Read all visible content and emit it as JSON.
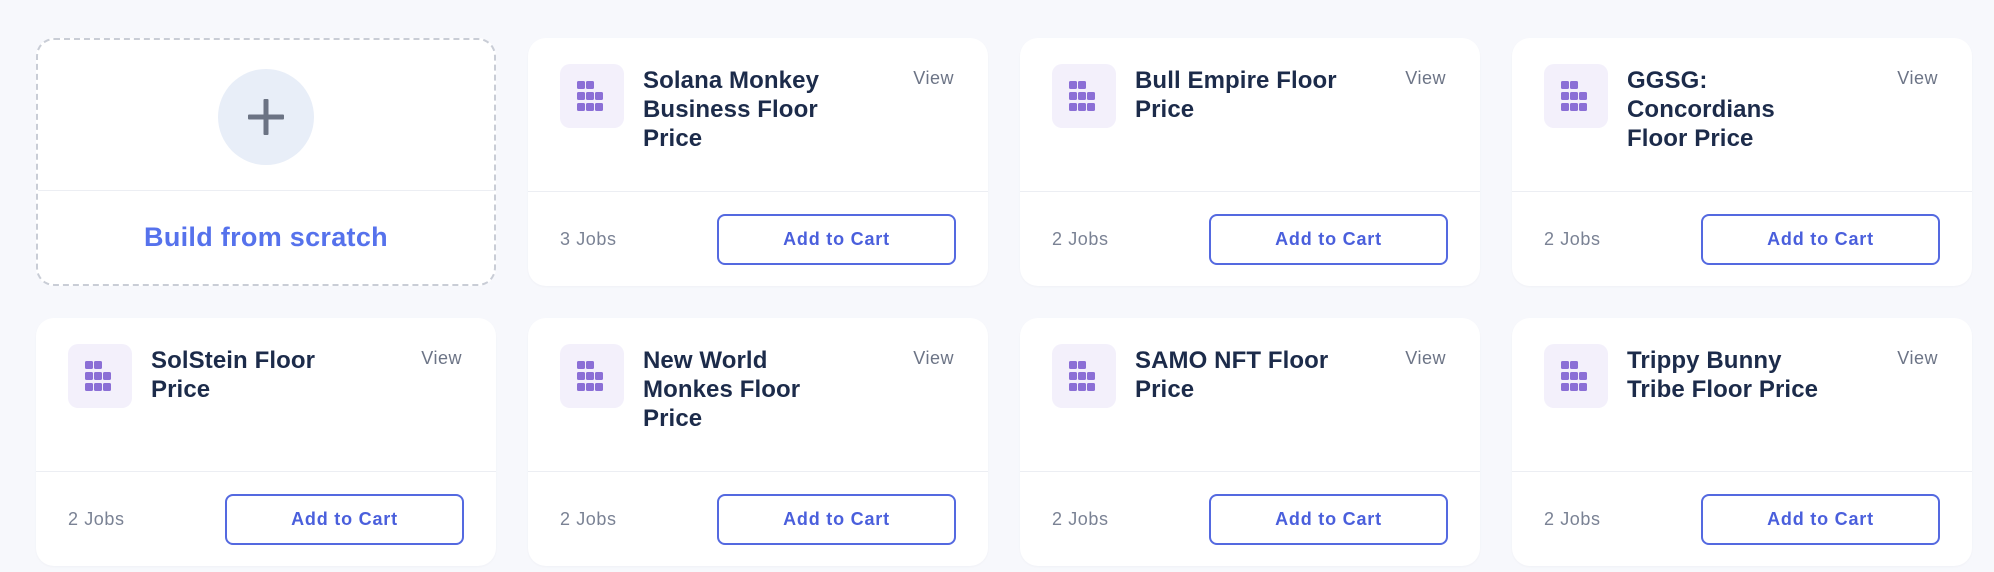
{
  "new_card": {
    "label": "Build from scratch",
    "icon": "plus-icon"
  },
  "templates": [
    {
      "title": "Solana Monkey Business Floor Price",
      "view_label": "View",
      "jobs": "3 Jobs",
      "cart_label": "Add to Cart",
      "icon": "blocks-icon"
    },
    {
      "title": "Bull Empire Floor Price",
      "view_label": "View",
      "jobs": "2 Jobs",
      "cart_label": "Add to Cart",
      "icon": "blocks-icon"
    },
    {
      "title": "GGSG: Concordians Floor Price",
      "view_label": "View",
      "jobs": "2 Jobs",
      "cart_label": "Add to Cart",
      "icon": "blocks-icon"
    },
    {
      "title": "SolStein Floor Price",
      "view_label": "View",
      "jobs": "2 Jobs",
      "cart_label": "Add to Cart",
      "icon": "blocks-icon"
    },
    {
      "title": "New World Monkes Floor Price",
      "view_label": "View",
      "jobs": "2 Jobs",
      "cart_label": "Add to Cart",
      "icon": "blocks-icon"
    },
    {
      "title": "SAMO NFT Floor Price",
      "view_label": "View",
      "jobs": "2 Jobs",
      "cart_label": "Add to Cart",
      "icon": "blocks-icon"
    },
    {
      "title": "Trippy Bunny Tribe Floor Price",
      "view_label": "View",
      "jobs": "2 Jobs",
      "cart_label": "Add to Cart",
      "icon": "blocks-icon"
    }
  ],
  "colors": {
    "accent": "#5469e0",
    "icon_purple": "#8b6fd6",
    "title_text": "#1c2b4a",
    "page_bg": "#f7f8fc"
  }
}
